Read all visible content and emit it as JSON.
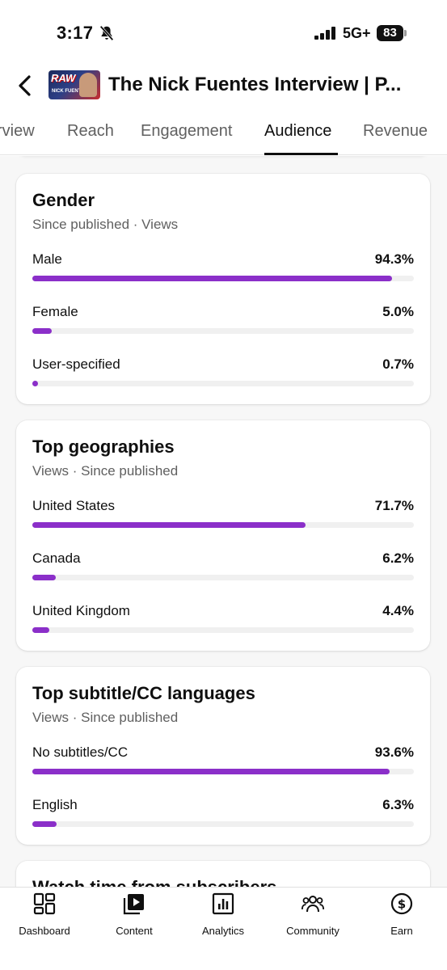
{
  "status_bar": {
    "time": "3:17",
    "network": "5G+",
    "battery": "83"
  },
  "header": {
    "title": "The Nick Fuentes Interview | P...",
    "thumbnail_text": "RAW",
    "thumbnail_subtext": "NICK FUENTES"
  },
  "tabs": [
    {
      "label": "rview"
    },
    {
      "label": "Reach"
    },
    {
      "label": "Engagement"
    },
    {
      "label": "Audience"
    },
    {
      "label": "Revenue"
    }
  ],
  "active_tab": "Audience",
  "accent_color": "#8b2fc9",
  "cards": {
    "gender": {
      "title": "Gender",
      "subtitle": "Since published · Views",
      "rows": [
        {
          "label": "Male",
          "value": "94.3%",
          "fraction": 0.943
        },
        {
          "label": "Female",
          "value": "5.0%",
          "fraction": 0.05
        },
        {
          "label": "User-specified",
          "value": "0.7%",
          "fraction": 0.007
        }
      ]
    },
    "geographies": {
      "title": "Top geographies",
      "subtitle": "Views · Since published",
      "rows": [
        {
          "label": "United States",
          "value": "71.7%",
          "fraction": 0.717
        },
        {
          "label": "Canada",
          "value": "6.2%",
          "fraction": 0.062
        },
        {
          "label": "United Kingdom",
          "value": "4.4%",
          "fraction": 0.044
        }
      ]
    },
    "subtitles": {
      "title": "Top subtitle/CC languages",
      "subtitle": "Views · Since published",
      "rows": [
        {
          "label": "No subtitles/CC",
          "value": "93.6%",
          "fraction": 0.936
        },
        {
          "label": "English",
          "value": "6.3%",
          "fraction": 0.063
        }
      ]
    },
    "watch_time": {
      "title": "Watch time from subscribers"
    }
  },
  "bottom_nav": [
    {
      "label": "Dashboard",
      "icon": "dashboard-icon"
    },
    {
      "label": "Content",
      "icon": "content-icon"
    },
    {
      "label": "Analytics",
      "icon": "analytics-icon"
    },
    {
      "label": "Community",
      "icon": "community-icon"
    },
    {
      "label": "Earn",
      "icon": "earn-icon"
    }
  ]
}
